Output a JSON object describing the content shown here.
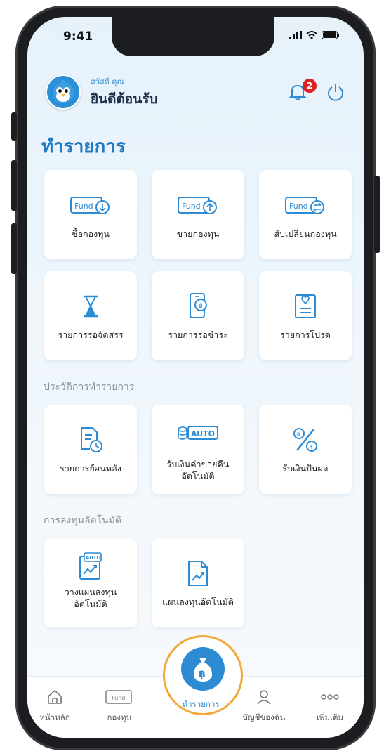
{
  "status_bar": {
    "time": "9:41"
  },
  "header": {
    "greeting_small": "สวัสดี คุณ",
    "greeting_big": "ยินดีต้อนรับ",
    "notification_count": "2"
  },
  "page_title": "ทำรายการ",
  "transactions": [
    {
      "label": "ซื้อกองทุน",
      "icon": "fund-buy-icon"
    },
    {
      "label": "ขายกองทุน",
      "icon": "fund-sell-icon"
    },
    {
      "label": "สับเปลี่ยนกองทุน",
      "icon": "fund-switch-icon"
    },
    {
      "label": "รายการรอจัดสรร",
      "icon": "hourglass-icon"
    },
    {
      "label": "รายการรอชำระ",
      "icon": "mobile-payment-icon"
    },
    {
      "label": "รายการโปรด",
      "icon": "favorite-list-icon"
    }
  ],
  "history_section": {
    "title": "ประวัติการทำรายการ",
    "items": [
      {
        "label": "รายการย้อนหลัง",
        "icon": "history-document-icon"
      },
      {
        "label": "รับเงินค่าขายคืน\nอัตโนมัติ",
        "icon": "auto-redemption-icon"
      },
      {
        "label": "รับเงินปันผล",
        "icon": "dividend-percent-icon"
      }
    ]
  },
  "auto_invest_section": {
    "title": "การลงทุนอัตโนมัติ",
    "items": [
      {
        "label": "วางแผนลงทุน\nอัตโนมัติ",
        "icon": "auto-plan-icon"
      },
      {
        "label": "แผนลงทุนอัตโนมัติ",
        "icon": "investment-plan-icon"
      }
    ]
  },
  "fund_text": "Fund",
  "auto_text": "AUTO",
  "nav": {
    "home": "หน้าหลัก",
    "funds": "กองทุน",
    "transactions": "ทำรายการ",
    "account": "บัญชีของฉัน",
    "more": "เพิ่มเติม"
  },
  "colors": {
    "primary": "#2d8bd4",
    "title": "#1f7cc4",
    "accent_ring": "#f2a93b",
    "badge": "#e02020"
  }
}
